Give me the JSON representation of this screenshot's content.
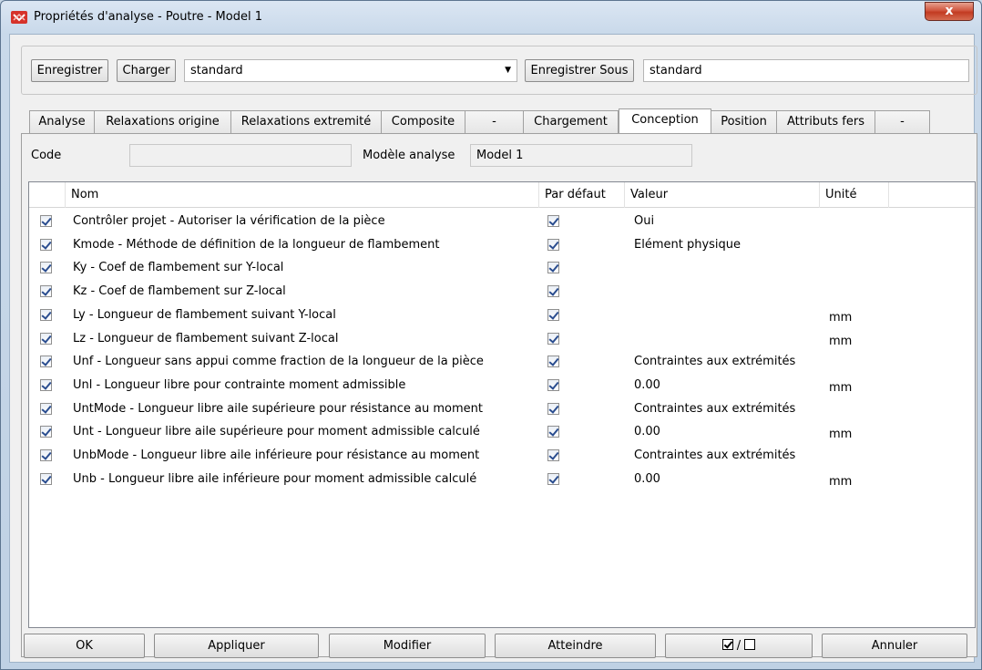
{
  "window": {
    "title": "Propriétés d'analyse - Poutre - Model 1",
    "close_glyph": "x"
  },
  "toolbar": {
    "save_label": "Enregistrer",
    "load_label": "Charger",
    "preset_value": "standard",
    "save_as_label": "Enregistrer Sous",
    "save_as_value": "standard"
  },
  "tabs": [
    {
      "label": "Analyse"
    },
    {
      "label": "Relaxations origine"
    },
    {
      "label": "Relaxations extremité"
    },
    {
      "label": "Composite"
    },
    {
      "label": "-"
    },
    {
      "label": "Chargement"
    },
    {
      "label": "Conception"
    },
    {
      "label": "Position"
    },
    {
      "label": "Attributs fers"
    },
    {
      "label": "-"
    }
  ],
  "active_tab": "Conception",
  "info": {
    "code_label": "Code",
    "code_value": "",
    "model_label": "Modèle analyse",
    "model_value": "Model 1"
  },
  "grid": {
    "columns": {
      "name": "Nom",
      "default": "Par défaut",
      "value": "Valeur",
      "unit": "Unité"
    },
    "rows": [
      {
        "checked": true,
        "name": "Contrôler projet - Autoriser la vérification de la pièce",
        "default": true,
        "value": "Oui",
        "unit": ""
      },
      {
        "checked": true,
        "name": "Kmode - Méthode de définition de la longueur de flambement",
        "default": true,
        "value": "Elément physique",
        "unit": ""
      },
      {
        "checked": true,
        "name": "Ky - Coef de flambement sur Y-local",
        "default": true,
        "value": "",
        "unit": ""
      },
      {
        "checked": true,
        "name": "Kz - Coef de flambement sur Z-local",
        "default": true,
        "value": "",
        "unit": ""
      },
      {
        "checked": true,
        "name": "Ly - Longueur de flambement suivant Y-local",
        "default": true,
        "value": "",
        "unit": "mm"
      },
      {
        "checked": true,
        "name": "Lz - Longueur de flambement suivant Z-local",
        "default": true,
        "value": "",
        "unit": "mm"
      },
      {
        "checked": true,
        "name": "Unf - Longueur sans appui comme fraction de la longueur de la pièce",
        "default": true,
        "value": "Contraintes aux extrémités",
        "unit": ""
      },
      {
        "checked": true,
        "name": "Unl - Longueur libre pour contrainte moment admissible",
        "default": true,
        "value": "0.00",
        "unit": "mm"
      },
      {
        "checked": true,
        "name": "UntMode - Longueur libre aile supérieure pour résistance au moment",
        "default": true,
        "value": "Contraintes aux extrémités",
        "unit": ""
      },
      {
        "checked": true,
        "name": "Unt - Longueur libre aile supérieure pour moment admissible calculé",
        "default": true,
        "value": "0.00",
        "unit": "mm"
      },
      {
        "checked": true,
        "name": "UnbMode - Longueur libre aile inférieure pour résistance au moment",
        "default": true,
        "value": "Contraintes aux extrémités",
        "unit": ""
      },
      {
        "checked": true,
        "name": "Unb - Longueur libre aile inférieure pour moment admissible calculé",
        "default": true,
        "value": "0.00",
        "unit": "mm"
      }
    ]
  },
  "buttons": {
    "ok": "OK",
    "apply": "Appliquer",
    "modify": "Modifier",
    "reach": "Atteindre",
    "toggle_separator": "/",
    "cancel": "Annuler"
  },
  "colors": {
    "accent": "#2a4d8f",
    "close": "#c23b22"
  }
}
